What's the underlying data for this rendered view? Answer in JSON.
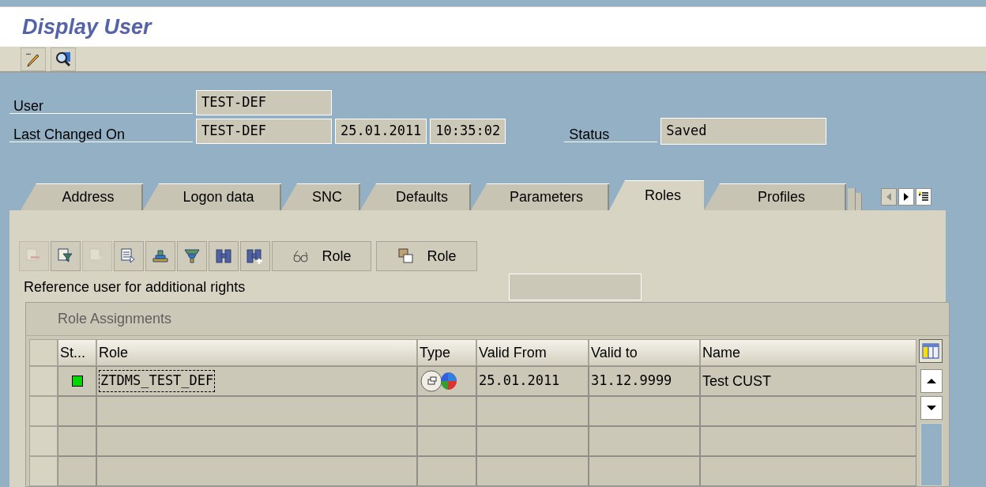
{
  "window": {
    "title": "Display User"
  },
  "header_fields": [
    {
      "label": "User",
      "values": [
        "TEST-DEF"
      ]
    },
    {
      "label": "Last Changed On",
      "values": [
        "TEST-DEF",
        "25.01.2011",
        "10:35:02"
      ]
    }
  ],
  "status": {
    "label": "Status",
    "value": "Saved"
  },
  "tabs": [
    {
      "label": "Address",
      "selected": false
    },
    {
      "label": "Logon data",
      "selected": false
    },
    {
      "label": "SNC",
      "selected": false
    },
    {
      "label": "Defaults",
      "selected": false
    },
    {
      "label": "Parameters",
      "selected": false
    },
    {
      "label": "Roles",
      "selected": true
    },
    {
      "label": "Profiles",
      "selected": false
    }
  ],
  "roles_toolbar": [
    {
      "disabled": true
    },
    {
      "disabled": false
    },
    {
      "disabled": true
    },
    {
      "disabled": false
    },
    {
      "disabled": false
    },
    {
      "disabled": false
    },
    {
      "disabled": false
    },
    {
      "disabled": false
    },
    {
      "disabled": false,
      "label": "Role"
    },
    {
      "disabled": false,
      "label": "Role"
    }
  ],
  "reference_user": {
    "label": "Reference user for additional rights"
  },
  "table": {
    "title": "Role Assignments",
    "columns": [
      "St...",
      "Role",
      "Type",
      "Valid From",
      "Valid to",
      "Name"
    ],
    "rows": [
      {
        "color": "#00d800",
        "role": "ZTDMS_TEST_DEF",
        "valid_from": "25.01.2011",
        "valid_to": "31.12.9999",
        "name": "Test CUST"
      }
    ]
  }
}
